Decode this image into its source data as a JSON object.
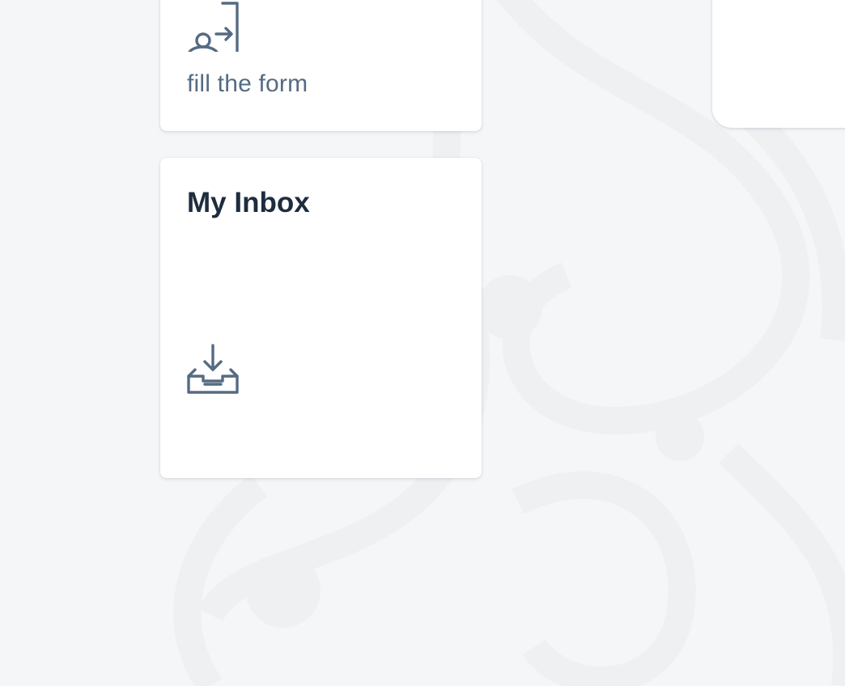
{
  "tiles": {
    "form": {
      "subtitle": "fill the form",
      "icon": "person-enter-icon"
    },
    "inbox": {
      "title": "My Inbox",
      "icon": "inbox-download-icon"
    }
  },
  "colors": {
    "background": "#f5f6f7",
    "tile": "#ffffff",
    "icon": "#556b82",
    "title": "#1d2d3e"
  }
}
